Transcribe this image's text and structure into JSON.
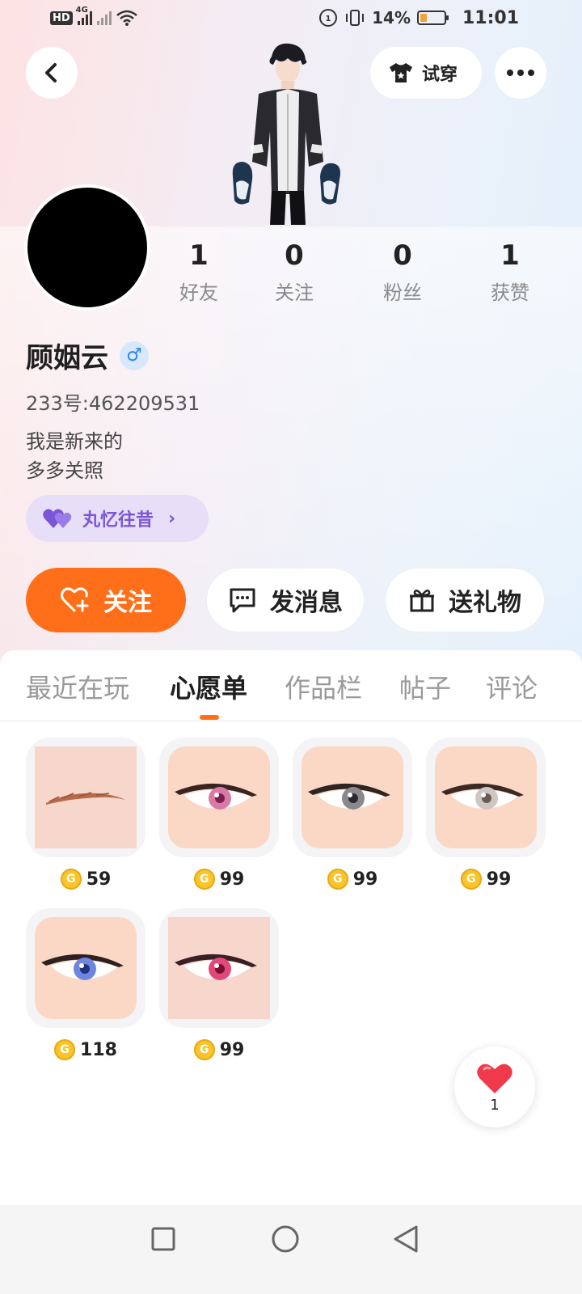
{
  "status_bar": {
    "hd_label": "HD",
    "network_label": "4G",
    "battery": "14%",
    "time": "11:01"
  },
  "header": {
    "try_on_label": "试穿"
  },
  "profile": {
    "stats": [
      {
        "value": "1",
        "label": "好友"
      },
      {
        "value": "0",
        "label": "关注"
      },
      {
        "value": "0",
        "label": "粉丝"
      },
      {
        "value": "1",
        "label": "获赞"
      }
    ],
    "name": "顾姻云",
    "gender_symbol": "♂",
    "uid": "233号:462209531",
    "bio_lines": [
      "我是新来的",
      "多多关照"
    ],
    "guild_name": "丸忆往昔"
  },
  "actions": {
    "follow": "关注",
    "message": "发消息",
    "gift": "送礼物"
  },
  "tabs": [
    "最近在玩",
    "心愿单",
    "作品栏",
    "帖子",
    "评论"
  ],
  "active_tab": "心愿单",
  "wishlist": [
    {
      "item": "eyebrow",
      "price": "59"
    },
    {
      "item": "eye-pink",
      "price": "99"
    },
    {
      "item": "eye-gray",
      "price": "99"
    },
    {
      "item": "eye-light",
      "price": "99"
    },
    {
      "item": "eye-blue",
      "price": "118"
    },
    {
      "item": "eye-red",
      "price": "99"
    }
  ],
  "like": {
    "count": "1"
  },
  "colors": {
    "accent": "#ff6f1a",
    "guild_purple": "#7b56d6",
    "coin_gold": "#f9c52a"
  }
}
